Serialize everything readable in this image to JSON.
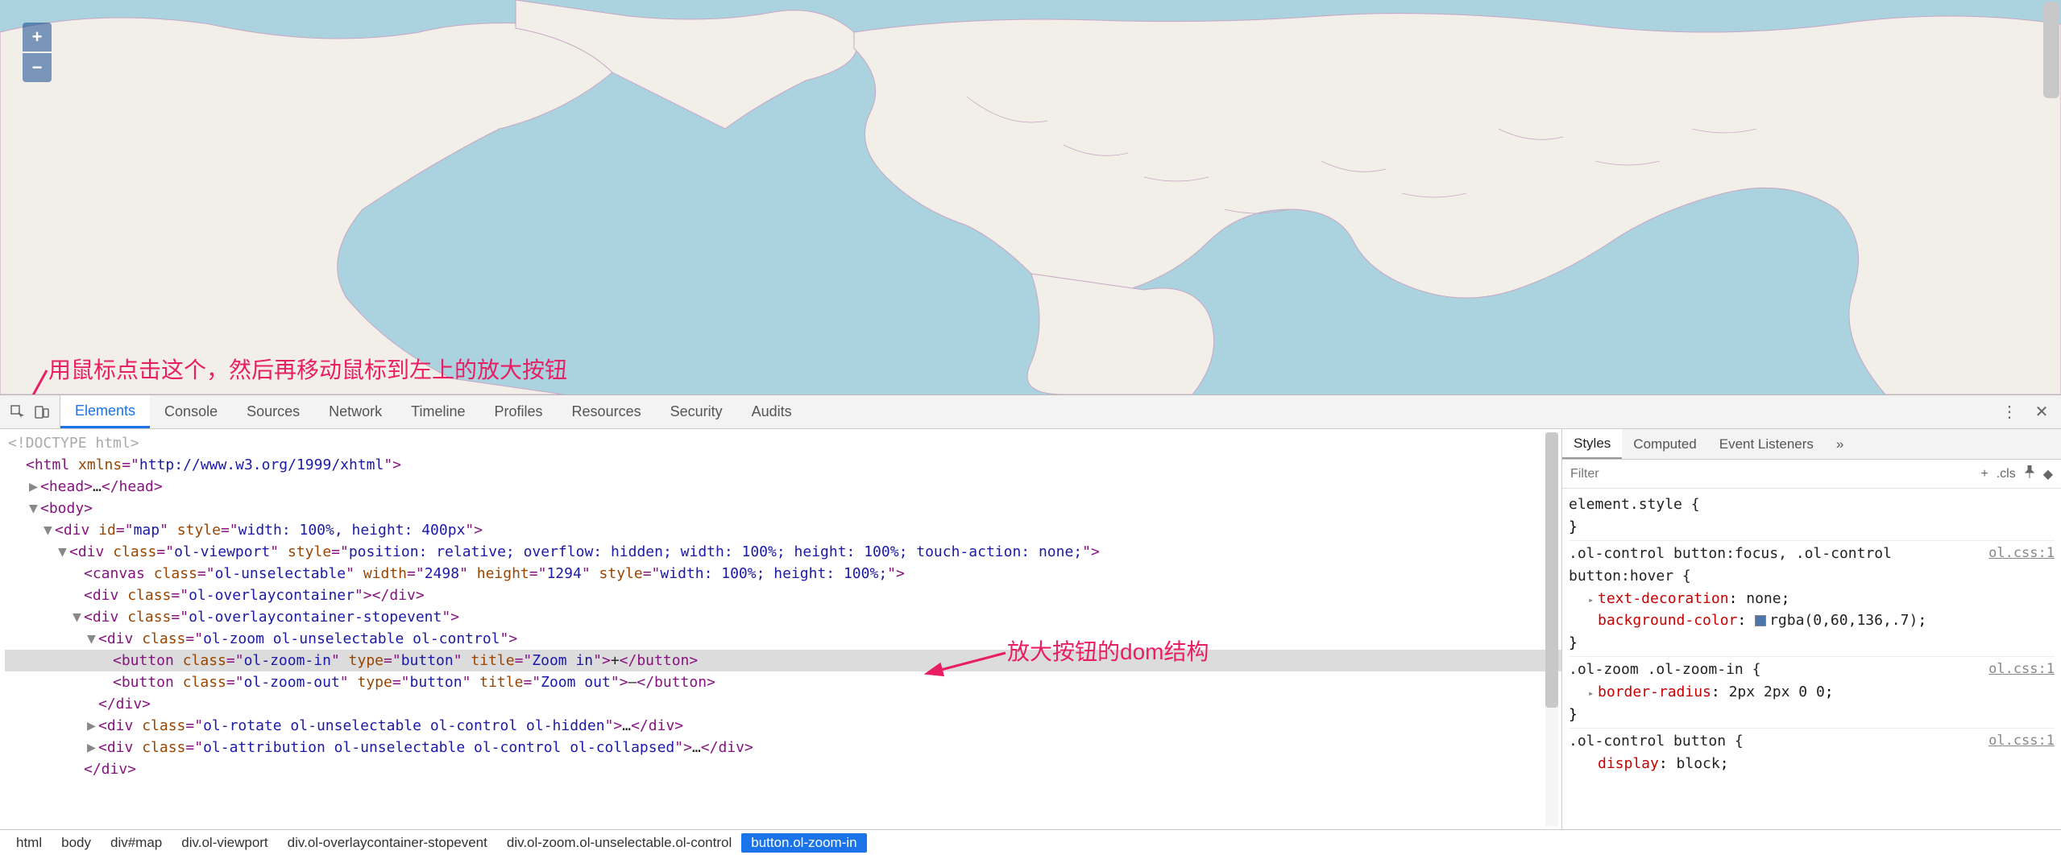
{
  "map": {
    "zoom_in_label": "+",
    "zoom_out_label": "−"
  },
  "annotations": {
    "top": "用鼠标点击这个，然后再移动鼠标到左上的放大按钮",
    "dom": "放大按钮的dom结构"
  },
  "devtools": {
    "tabs": [
      "Elements",
      "Console",
      "Sources",
      "Network",
      "Timeline",
      "Profiles",
      "Resources",
      "Security",
      "Audits"
    ],
    "active_tab": 0,
    "menu_icon": "⋮",
    "close_icon": "✕"
  },
  "dom": {
    "doctype": "<!DOCTYPE html>",
    "lines": [
      {
        "indent": 0,
        "twisty": "",
        "content": [
          [
            "tag",
            "<html "
          ],
          [
            "attr",
            "xmlns"
          ],
          [
            "tag",
            "=\""
          ],
          [
            "val",
            "http://www.w3.org/1999/xhtml"
          ],
          [
            "tag",
            "\">"
          ]
        ]
      },
      {
        "indent": 1,
        "twisty": "▶",
        "content": [
          [
            "tag",
            "<head>"
          ],
          [
            "text",
            "…"
          ],
          [
            "tag",
            "</head>"
          ]
        ]
      },
      {
        "indent": 1,
        "twisty": "▼",
        "content": [
          [
            "tag",
            "<body>"
          ]
        ]
      },
      {
        "indent": 2,
        "twisty": "▼",
        "content": [
          [
            "tag",
            "<div "
          ],
          [
            "attr",
            "id"
          ],
          [
            "tag",
            "=\""
          ],
          [
            "val",
            "map"
          ],
          [
            "tag",
            "\" "
          ],
          [
            "attr",
            "style"
          ],
          [
            "tag",
            "=\""
          ],
          [
            "val",
            "width: 100%, height: 400px"
          ],
          [
            "tag",
            "\">"
          ]
        ]
      },
      {
        "indent": 3,
        "twisty": "▼",
        "content": [
          [
            "tag",
            "<div "
          ],
          [
            "attr",
            "class"
          ],
          [
            "tag",
            "=\""
          ],
          [
            "val",
            "ol-viewport"
          ],
          [
            "tag",
            "\" "
          ],
          [
            "attr",
            "style"
          ],
          [
            "tag",
            "=\""
          ],
          [
            "val",
            "position: relative; overflow: hidden; width: 100%; height: 100%; touch-action: none;"
          ],
          [
            "tag",
            "\">"
          ]
        ]
      },
      {
        "indent": 4,
        "twisty": "",
        "content": [
          [
            "tag",
            "<canvas "
          ],
          [
            "attr",
            "class"
          ],
          [
            "tag",
            "=\""
          ],
          [
            "val",
            "ol-unselectable"
          ],
          [
            "tag",
            "\" "
          ],
          [
            "attr",
            "width"
          ],
          [
            "tag",
            "=\""
          ],
          [
            "val",
            "2498"
          ],
          [
            "tag",
            "\" "
          ],
          [
            "attr",
            "height"
          ],
          [
            "tag",
            "=\""
          ],
          [
            "val",
            "1294"
          ],
          [
            "tag",
            "\" "
          ],
          [
            "attr",
            "style"
          ],
          [
            "tag",
            "=\""
          ],
          [
            "val",
            "width: 100%; height: 100%;"
          ],
          [
            "tag",
            "\">"
          ]
        ]
      },
      {
        "indent": 4,
        "twisty": "",
        "content": [
          [
            "tag",
            "<div "
          ],
          [
            "attr",
            "class"
          ],
          [
            "tag",
            "=\""
          ],
          [
            "val",
            "ol-overlaycontainer"
          ],
          [
            "tag",
            "\"></div>"
          ]
        ]
      },
      {
        "indent": 4,
        "twisty": "▼",
        "content": [
          [
            "tag",
            "<div "
          ],
          [
            "attr",
            "class"
          ],
          [
            "tag",
            "=\""
          ],
          [
            "val",
            "ol-overlaycontainer-stopevent"
          ],
          [
            "tag",
            "\">"
          ]
        ]
      },
      {
        "indent": 5,
        "twisty": "▼",
        "content": [
          [
            "tag",
            "<div "
          ],
          [
            "attr",
            "class"
          ],
          [
            "tag",
            "=\""
          ],
          [
            "val",
            "ol-zoom ol-unselectable ol-control"
          ],
          [
            "tag",
            "\">"
          ]
        ]
      },
      {
        "indent": 6,
        "twisty": "",
        "highlight": true,
        "content": [
          [
            "tag",
            "<button "
          ],
          [
            "attr",
            "class"
          ],
          [
            "tag",
            "=\""
          ],
          [
            "val",
            "ol-zoom-in"
          ],
          [
            "tag",
            "\" "
          ],
          [
            "attr",
            "type"
          ],
          [
            "tag",
            "=\""
          ],
          [
            "val",
            "button"
          ],
          [
            "tag",
            "\" "
          ],
          [
            "attr",
            "title"
          ],
          [
            "tag",
            "=\""
          ],
          [
            "val",
            "Zoom in"
          ],
          [
            "tag",
            "\">"
          ],
          [
            "text",
            "+"
          ],
          [
            "tag",
            "</button>"
          ]
        ]
      },
      {
        "indent": 6,
        "twisty": "",
        "content": [
          [
            "tag",
            "<button "
          ],
          [
            "attr",
            "class"
          ],
          [
            "tag",
            "=\""
          ],
          [
            "val",
            "ol-zoom-out"
          ],
          [
            "tag",
            "\" "
          ],
          [
            "attr",
            "type"
          ],
          [
            "tag",
            "=\""
          ],
          [
            "val",
            "button"
          ],
          [
            "tag",
            "\" "
          ],
          [
            "attr",
            "title"
          ],
          [
            "tag",
            "=\""
          ],
          [
            "val",
            "Zoom out"
          ],
          [
            "tag",
            "\">"
          ],
          [
            "text",
            "–"
          ],
          [
            "tag",
            "</button>"
          ]
        ]
      },
      {
        "indent": 5,
        "twisty": "",
        "content": [
          [
            "tag",
            "</div>"
          ]
        ]
      },
      {
        "indent": 5,
        "twisty": "▶",
        "content": [
          [
            "tag",
            "<div "
          ],
          [
            "attr",
            "class"
          ],
          [
            "tag",
            "=\""
          ],
          [
            "val",
            "ol-rotate ol-unselectable ol-control ol-hidden"
          ],
          [
            "tag",
            "\">"
          ],
          [
            "text",
            "…"
          ],
          [
            "tag",
            "</div>"
          ]
        ]
      },
      {
        "indent": 5,
        "twisty": "▶",
        "content": [
          [
            "tag",
            "<div "
          ],
          [
            "attr",
            "class"
          ],
          [
            "tag",
            "=\""
          ],
          [
            "val",
            "ol-attribution ol-unselectable ol-control ol-collapsed"
          ],
          [
            "tag",
            "\">"
          ],
          [
            "text",
            "…"
          ],
          [
            "tag",
            "</div>"
          ]
        ]
      },
      {
        "indent": 4,
        "twisty": "",
        "content": [
          [
            "tag",
            "</div>"
          ]
        ]
      }
    ]
  },
  "sidebar": {
    "tabs": [
      "Styles",
      "Computed",
      "Event Listeners"
    ],
    "more_icon": "»",
    "active_tab": 0,
    "filter_placeholder": "Filter",
    "plus_icon": "+",
    "cls_label": ".cls",
    "pin_icon": "📌",
    "tack_icon": "◆"
  },
  "styles": {
    "rules": [
      {
        "selector": "element.style {",
        "link": "",
        "props": [],
        "close": "}"
      },
      {
        "selector": ".ol-control button:focus, .ol-control button:hover {",
        "link": "ol.css:1",
        "props": [
          {
            "name": "text-decoration",
            "val": "none",
            "tw": "▸"
          },
          {
            "name": "background-color",
            "val": "rgba(0,60,136,.7)",
            "color": true
          }
        ],
        "close": "}"
      },
      {
        "selector": ".ol-zoom .ol-zoom-in {",
        "link": "ol.css:1",
        "props": [
          {
            "name": "border-radius",
            "val": "2px 2px 0 0",
            "tw": "▸"
          }
        ],
        "close": "}"
      },
      {
        "selector": ".ol-control button {",
        "link": "ol.css:1",
        "props": [
          {
            "name": "display",
            "val": "block"
          }
        ],
        "close": ""
      }
    ]
  },
  "breadcrumbs": [
    "html",
    "body",
    "div#map",
    "div.ol-viewport",
    "div.ol-overlaycontainer-stopevent",
    "div.ol-zoom.ol-unselectable.ol-control",
    "button.ol-zoom-in"
  ]
}
